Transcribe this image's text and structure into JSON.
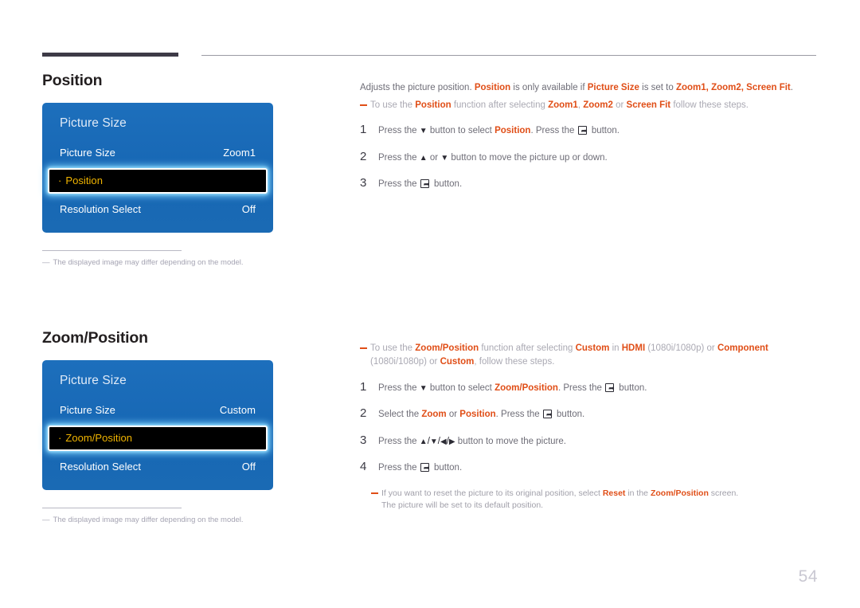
{
  "page": {
    "number": "54"
  },
  "sections": [
    {
      "heading": "Position",
      "osd": {
        "title": "Picture Size",
        "rows": [
          {
            "label": "Picture Size",
            "value": "Zoom1",
            "highlighted": false
          },
          {
            "label": "Position",
            "value": "",
            "highlighted": true
          },
          {
            "label": "Resolution Select",
            "value": "Off",
            "highlighted": false
          }
        ]
      },
      "footnote": "The displayed image may differ depending on the model.",
      "intro": {
        "part1": "Adjusts the picture position. ",
        "b1": "Position",
        "part2": " is only available if ",
        "b2": "Picture Size",
        "part3": " is set to ",
        "b3": "Zoom1, Zoom2, Screen Fit",
        "part4": "."
      },
      "tip": {
        "part1": "To use the ",
        "b1": "Position",
        "part2": " function after selecting ",
        "b2": "Zoom1",
        "part3": ", ",
        "b3": "Zoom2",
        "part4": " or ",
        "b4": "Screen Fit",
        "part5": " follow these steps."
      },
      "steps": [
        {
          "num": "1",
          "p1": "Press the ",
          "icon1": "arrow-down",
          "p2": " button to select ",
          "b1": "Position",
          "p3": ". Press the ",
          "icon2": "enter-button",
          "p4": " button."
        },
        {
          "num": "2",
          "p1": "Press the ",
          "icon1": "arrow-up",
          "p2": " or ",
          "icon2": "arrow-down",
          "p3": " button to move the picture up or down.",
          "b1": "",
          "p4": ""
        },
        {
          "num": "3",
          "p1": "Press the ",
          "icon1": "enter-button",
          "p2": " button.",
          "b1": "",
          "p3": "",
          "p4": ""
        }
      ]
    },
    {
      "heading": "Zoom/Position",
      "osd": {
        "title": "Picture Size",
        "rows": [
          {
            "label": "Picture Size",
            "value": "Custom",
            "highlighted": false
          },
          {
            "label": "Zoom/Position",
            "value": "",
            "highlighted": true
          },
          {
            "label": "Resolution Select",
            "value": "Off",
            "highlighted": false
          }
        ]
      },
      "footnote": "The displayed image may differ depending on the model.",
      "tip": {
        "part1": "To use the ",
        "b1": "Zoom/Position",
        "part2": " function after selecting ",
        "b2": "Custom",
        "part3": " in ",
        "b3": "HDMI",
        "part4": " (1080i/1080p) or ",
        "b4": "Component",
        "part5": " (1080i/1080p) or ",
        "b5": "Custom",
        "part6": ", follow these steps."
      },
      "steps": [
        {
          "num": "1",
          "p1": "Press the ",
          "icon1": "arrow-down",
          "p2": " button to select ",
          "b1": "Zoom/Position",
          "p3": ". Press the ",
          "icon2": "enter-button",
          "p4": " button."
        },
        {
          "num": "2",
          "p1": "Select the ",
          "b1": "Zoom",
          "p2": " or ",
          "b2": "Position",
          "p3": ". Press the ",
          "icon2": "enter-button",
          "p4": " button."
        },
        {
          "num": "3",
          "p1": "Press the ",
          "icons": "arrow-up/arrow-down/arrow-left/arrow-right",
          "p2": " button to move the picture."
        },
        {
          "num": "4",
          "p1": "Press the ",
          "icon1": "enter-button",
          "p2": " button."
        }
      ],
      "bottom_note": {
        "l1a": "If you want to reset the picture to its original position, select ",
        "l1b": "Reset",
        "l1c": " in the ",
        "l1d": "Zoom/Position",
        "l1e": " screen.",
        "l2": "The picture will be set to its default position."
      }
    }
  ],
  "colors": {
    "accent_orange": "#e04e17",
    "osd_blue": "#1767b4",
    "osd_highlight_text": "#f0b400",
    "rule_dark": "#3d3a47"
  }
}
